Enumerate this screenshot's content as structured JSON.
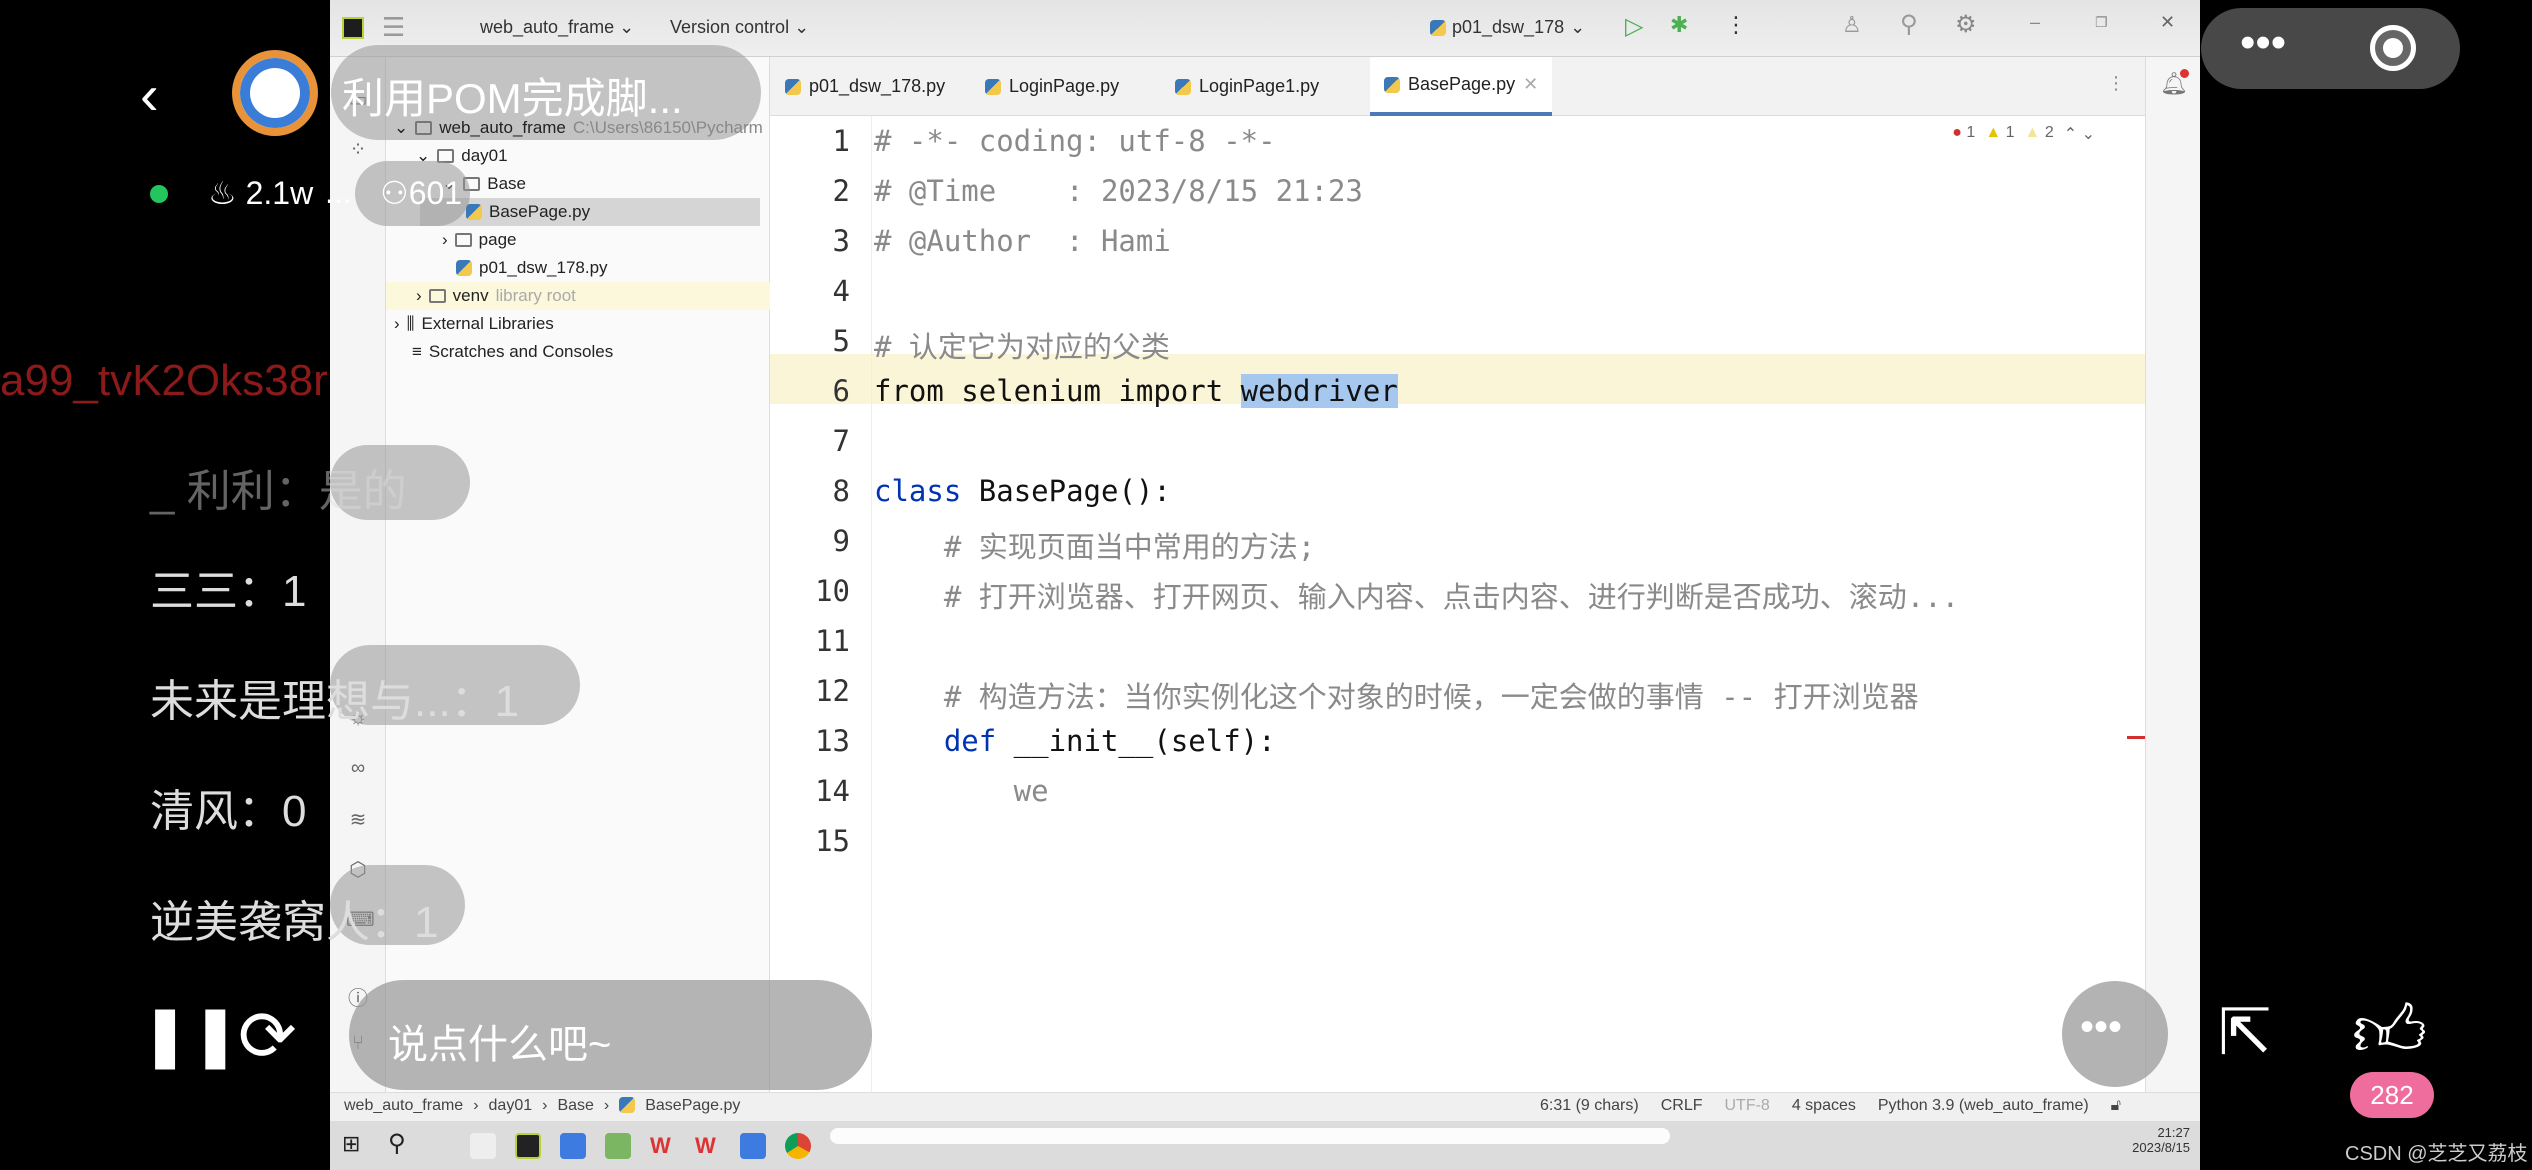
{
  "ide": {
    "project_menu": "web_auto_frame",
    "vcs_menu": "Version control",
    "run_config": "p01_dsw_178",
    "tabs": [
      {
        "label": "p01_dsw_178.py"
      },
      {
        "label": "LoginPage.py"
      },
      {
        "label": "LoginPage1.py"
      },
      {
        "label": "BasePage.py",
        "active": true
      }
    ],
    "tree": [
      {
        "label": "web_auto_frame",
        "extra": "C:\\Users\\86150\\Pycharm"
      },
      {
        "label": "day01"
      },
      {
        "label": "Base"
      },
      {
        "label": "BasePage.py",
        "selected": true
      },
      {
        "label": "page"
      },
      {
        "label": "p01_dsw_178.py"
      },
      {
        "label": "venv",
        "extra": "library root"
      },
      {
        "label": "External Libraries"
      },
      {
        "label": "Scratches and Consoles"
      }
    ],
    "inspections": {
      "errors": "1",
      "warnings": "1",
      "weak": "2"
    },
    "code": [
      {
        "n": "1",
        "text": "# -*- coding: utf-8 -*-"
      },
      {
        "n": "2",
        "text": "# @Time    : 2023/8/15 21:23"
      },
      {
        "n": "3",
        "text": "# @Author  : Hami"
      },
      {
        "n": "4",
        "text": ""
      },
      {
        "n": "5",
        "text": "# 认定它为对应的父类"
      },
      {
        "n": "6",
        "kw": "from selenium import ",
        "sel": "webdriver"
      },
      {
        "n": "7",
        "text": ""
      },
      {
        "n": "8",
        "kw": "class",
        "rest": " BasePage():"
      },
      {
        "n": "9",
        "text": "    # 实现页面当中常用的方法;"
      },
      {
        "n": "10",
        "text": "    # 打开浏览器、打开网页、输入内容、点击内容、进行判断是否成功、滚动..."
      },
      {
        "n": "11",
        "text": ""
      },
      {
        "n": "12",
        "text": "    # 构造方法：当你实例化这个对象的时候，一定会做的事情 -- 打开浏览器"
      },
      {
        "n": "13",
        "kw": "    def",
        "rest": " __init__(self):"
      },
      {
        "n": "14",
        "text": "        we"
      },
      {
        "n": "15",
        "text": ""
      }
    ],
    "breadcrumb": [
      "web_auto_frame",
      "day01",
      "Base",
      "BasePage.py"
    ],
    "status": {
      "position": "6:31 (9 chars)",
      "line_sep": "CRLF",
      "encoding": "UTF-8",
      "indent": "4 spaces",
      "interpreter": "Python 3.9 (web_auto_frame)"
    },
    "clock": {
      "time": "21:27",
      "date": "2023/8/15"
    }
  },
  "live": {
    "title": "利用POM完成脚...",
    "heat": "2.1w",
    "viewers": "601",
    "more": "...",
    "comments": [
      {
        "text": "a99_tvK2Oks38r",
        "color": "#8b1a1a"
      },
      {
        "text": "_ 利利：是的"
      },
      {
        "text": "三三：1"
      },
      {
        "text": "未来是理想与...：1"
      },
      {
        "text": "清风：0"
      },
      {
        "text": "逆美袭窝人：1"
      }
    ],
    "input_placeholder": "说点什么吧~",
    "likes": "282",
    "watermark": "CSDN @芝芝又荔枝"
  }
}
